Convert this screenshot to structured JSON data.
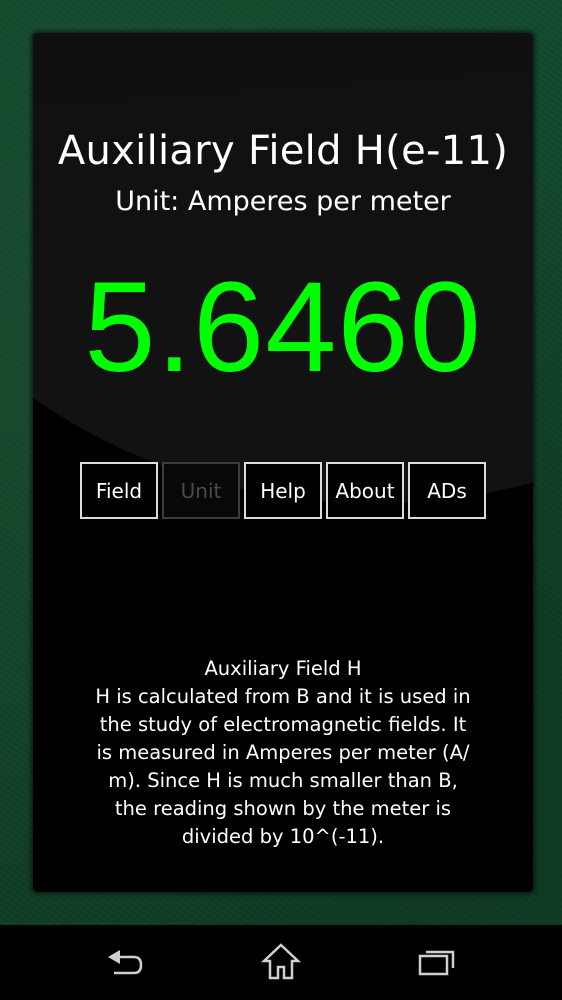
{
  "screen": {
    "title": "Auxiliary Field H(e-11)",
    "unit_label": "Unit: Amperes per meter",
    "reading": "5.6460",
    "reading_color": "#00ff00",
    "background_color": "#12442a"
  },
  "toolbar": {
    "buttons": [
      {
        "label": "Field",
        "enabled": true
      },
      {
        "label": "Unit",
        "enabled": false
      },
      {
        "label": "Help",
        "enabled": true
      },
      {
        "label": "About",
        "enabled": true
      },
      {
        "label": "ADs",
        "enabled": true
      }
    ]
  },
  "description": {
    "lines": [
      "Auxiliary Field H",
      "H is calculated from B and it is used in",
      "the study of electromagnetic fields. It",
      "is measured in Amperes per meter (A/",
      "m). Since H is much smaller than B,",
      "the reading shown by the meter is",
      "divided by 10^(-11)."
    ]
  },
  "navbar": {
    "back_icon": "back-arrow",
    "home_icon": "house",
    "recents_icon": "stacked-windows"
  }
}
